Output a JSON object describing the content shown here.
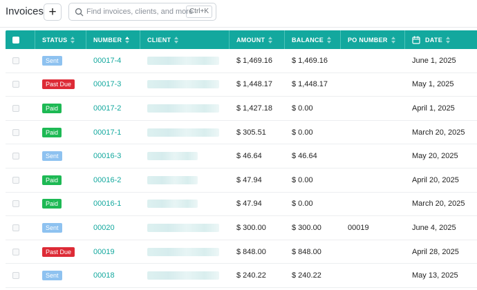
{
  "header": {
    "title": "Invoices",
    "add_label": "+",
    "search_placeholder": "Find invoices, clients, and more",
    "search_shortcut": "Ctrl+K"
  },
  "table": {
    "columns": [
      "STATUS",
      "NUMBER",
      "CLIENT",
      "AMOUNT",
      "BALANCE",
      "PO NUMBER",
      "DATE"
    ],
    "rows": [
      {
        "status": "Sent",
        "status_type": "sent",
        "number": "00017-4",
        "client": "",
        "amount": "$ 1,469.16",
        "balance": "$ 1,469.16",
        "po": "",
        "date": "June 1, 2025"
      },
      {
        "status": "Past Due",
        "status_type": "pastdue",
        "number": "00017-3",
        "client": "",
        "amount": "$ 1,448.17",
        "balance": "$ 1,448.17",
        "po": "",
        "date": "May 1, 2025"
      },
      {
        "status": "Paid",
        "status_type": "paid",
        "number": "00017-2",
        "client": "",
        "amount": "$ 1,427.18",
        "balance": "$ 0.00",
        "po": "",
        "date": "April 1, 2025"
      },
      {
        "status": "Paid",
        "status_type": "paid",
        "number": "00017-1",
        "client": "",
        "amount": "$ 305.51",
        "balance": "$ 0.00",
        "po": "",
        "date": "March 20, 2025"
      },
      {
        "status": "Sent",
        "status_type": "sent",
        "number": "00016-3",
        "client": "",
        "amount": "$ 46.64",
        "balance": "$ 46.64",
        "po": "",
        "date": "May 20, 2025"
      },
      {
        "status": "Paid",
        "status_type": "paid",
        "number": "00016-2",
        "client": "",
        "amount": "$ 47.94",
        "balance": "$ 0.00",
        "po": "",
        "date": "April 20, 2025"
      },
      {
        "status": "Paid",
        "status_type": "paid",
        "number": "00016-1",
        "client": "",
        "amount": "$ 47.94",
        "balance": "$ 0.00",
        "po": "",
        "date": "March 20, 2025"
      },
      {
        "status": "Sent",
        "status_type": "sent",
        "number": "00020",
        "client": "",
        "amount": "$ 300.00",
        "balance": "$ 300.00",
        "po": "00019",
        "date": "June 4, 2025"
      },
      {
        "status": "Past Due",
        "status_type": "pastdue",
        "number": "00019",
        "client": "",
        "amount": "$ 848.00",
        "balance": "$ 848.00",
        "po": "",
        "date": "April 28, 2025"
      },
      {
        "status": "Sent",
        "status_type": "sent",
        "number": "00018",
        "client": "",
        "amount": "$ 240.22",
        "balance": "$ 240.22",
        "po": "",
        "date": "May 13, 2025"
      }
    ]
  },
  "colors": {
    "accent": "#13a89e",
    "sent": "#8ec2f0",
    "past_due": "#dd2b36",
    "paid": "#1db954"
  }
}
